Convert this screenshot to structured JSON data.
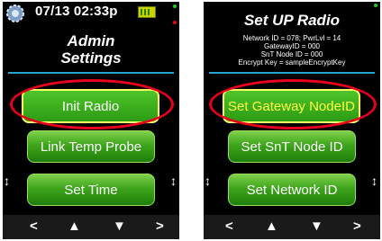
{
  "screen1": {
    "datetime": "07/13 02:33p",
    "title_line1": "Admin",
    "title_line2": "Settings",
    "buttons": [
      "Init Radio",
      "Link Temp Probe",
      "Set Time"
    ]
  },
  "screen2": {
    "title": "Set UP Radio",
    "info": [
      "Network ID = 078; PwrLvl = 14",
      "GatewayID = 000",
      "SnT Node ID = 000",
      "Encrypt Key = sampleEncryptKey"
    ],
    "buttons": [
      "Set Gateway NodeID",
      "Set SnT Node ID",
      "Set Network ID"
    ]
  },
  "nav": {
    "left": "<",
    "up": "▲",
    "down": "▼",
    "right": ">",
    "scroll": "↕"
  },
  "colors": {
    "button_green": "#3ea51c",
    "highlight_ring": "#e8001c",
    "separator": "#29a3d6",
    "selected_text": "#ffff44"
  }
}
